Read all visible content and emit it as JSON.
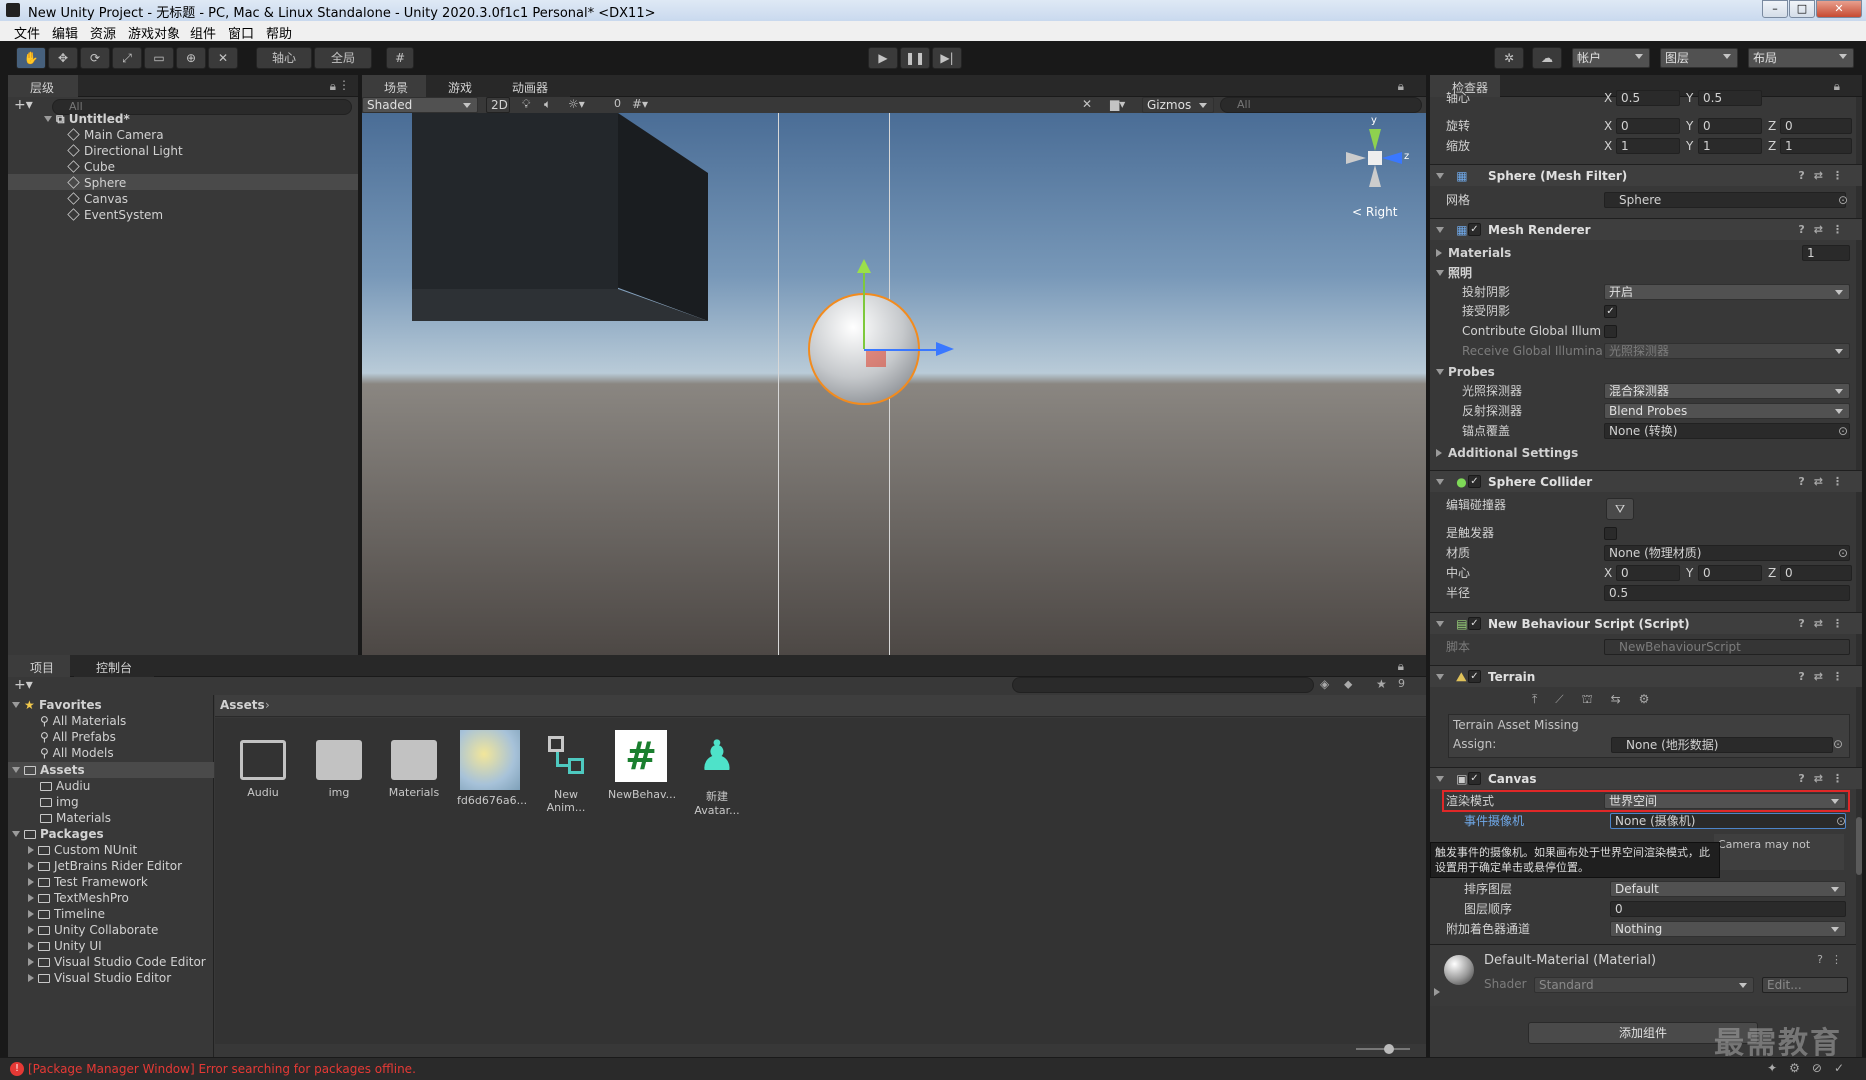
{
  "window": {
    "title": "New Unity Project - 无标题 - PC, Mac & Linux Standalone - Unity 2020.3.0f1c1 Personal* <DX11>"
  },
  "menu": [
    "文件",
    "编辑",
    "资源",
    "游戏对象",
    "组件",
    "窗口",
    "帮助"
  ],
  "toolbar": {
    "pivot": "轴心",
    "global": "全局",
    "account": "帐户",
    "layers": "图层",
    "layout": "布局"
  },
  "hierarchy": {
    "tab": "层级",
    "search": "All",
    "scene": "Untitled*",
    "items": [
      "Main Camera",
      "Directional Light",
      "Cube",
      "Sphere",
      "Canvas",
      "EventSystem"
    ]
  },
  "scene": {
    "tabs": [
      "场景",
      "游戏",
      "动画器"
    ],
    "shading": "Shaded",
    "mode2d": "2D",
    "fx_count": "0",
    "gizmos": "Gizmos",
    "search": "All",
    "orient": "< Right",
    "axis_y": "y",
    "axis_z": "z"
  },
  "project": {
    "tabs": [
      "项目",
      "控制台"
    ],
    "hidden_count": "9",
    "favorites": {
      "label": "Favorites",
      "items": [
        "All Materials",
        "All Prefabs",
        "All Models"
      ]
    },
    "assets": {
      "label": "Assets",
      "items": [
        "Audiu",
        "img",
        "Materials"
      ]
    },
    "packages": {
      "label": "Packages",
      "items": [
        "Custom NUnit",
        "JetBrains Rider Editor",
        "Test Framework",
        "TextMeshPro",
        "Timeline",
        "Unity Collaborate",
        "Unity UI",
        "Visual Studio Code Editor",
        "Visual Studio Editor"
      ]
    },
    "breadcrumb": "Assets",
    "grid": [
      {
        "name": "Audiu",
        "icon": "folder-icon"
      },
      {
        "name": "img",
        "icon": "folder-icon"
      },
      {
        "name": "Materials",
        "icon": "folder-icon"
      },
      {
        "name": "fd6d676a6...",
        "icon": "image-thumbnail"
      },
      {
        "name": "New Anim...",
        "icon": "animator-icon"
      },
      {
        "name": "NewBehav...",
        "icon": "script-icon"
      },
      {
        "name": "新建 Avatar...",
        "icon": "avatar-icon"
      }
    ]
  },
  "status": {
    "error": "[Package Manager Window] Error searching for packages offline."
  },
  "inspector": {
    "tab": "检查器",
    "pivot": {
      "label": "轴心",
      "x": "0.5",
      "y": "0.5"
    },
    "rotation": {
      "label": "旋转",
      "x": "0",
      "y": "0",
      "z": "0"
    },
    "scale": {
      "label": "缩放",
      "x": "1",
      "y": "1",
      "z": "1"
    },
    "mesh_filter": {
      "title": "Sphere (Mesh Filter)",
      "mesh_label": "网格",
      "mesh": "Sphere"
    },
    "mesh_renderer": {
      "title": "Mesh Renderer",
      "materials": "Materials",
      "materials_count": "1",
      "lighting": "照明",
      "cast_label": "投射阴影",
      "cast": "开启",
      "receive_label": "接受阴影",
      "gi_label": "Contribute Global Illumir",
      "rgi_label": "Receive Global Illuminati",
      "rgi": "光照探测器",
      "probes": "Probes",
      "light_probes_label": "光照探测器",
      "light_probes": "混合探测器",
      "refl_label": "反射探测器",
      "refl": "Blend Probes",
      "anchor_label": "锚点覆盖",
      "anchor": "None (转换)",
      "additional": "Additional Settings"
    },
    "sphere_collider": {
      "title": "Sphere Collider",
      "edit_label": "编辑碰撞器",
      "trigger_label": "是触发器",
      "material_label": "材质",
      "material": "None (物理材质)",
      "center_label": "中心",
      "cx": "0",
      "cy": "0",
      "cz": "0",
      "radius_label": "半径",
      "radius": "0.5"
    },
    "script": {
      "title": "New Behaviour Script (Script)",
      "label": "脚本",
      "value": "NewBehaviourScript"
    },
    "terrain": {
      "title": "Terrain",
      "missing": "Terrain Asset Missing",
      "assign_label": "Assign:",
      "assign": "None (地形数据)"
    },
    "canvas": {
      "title": "Canvas",
      "render_mode_label": "渲染模式",
      "render_mode": "世界空间",
      "event_camera_label": "事件摄像机",
      "event_camera": "None (摄像机)",
      "tooltip": "触发事件的摄像机。如果画布处于世界空间渲染模式，此设置用于确定单击或悬停位置。",
      "warn": "Camera may not",
      "sort_layer_label": "排序图层",
      "sort_layer": "Default",
      "order_label": "图层顺序",
      "order": "0",
      "shader_ch_label": "附加着色器通道",
      "shader_ch": "Nothing"
    },
    "material": {
      "title": "Default-Material (Material)",
      "shader_label": "Shader",
      "shader": "Standard",
      "edit": "Edit..."
    },
    "add_component": "添加组件"
  },
  "watermark": "最需教育"
}
